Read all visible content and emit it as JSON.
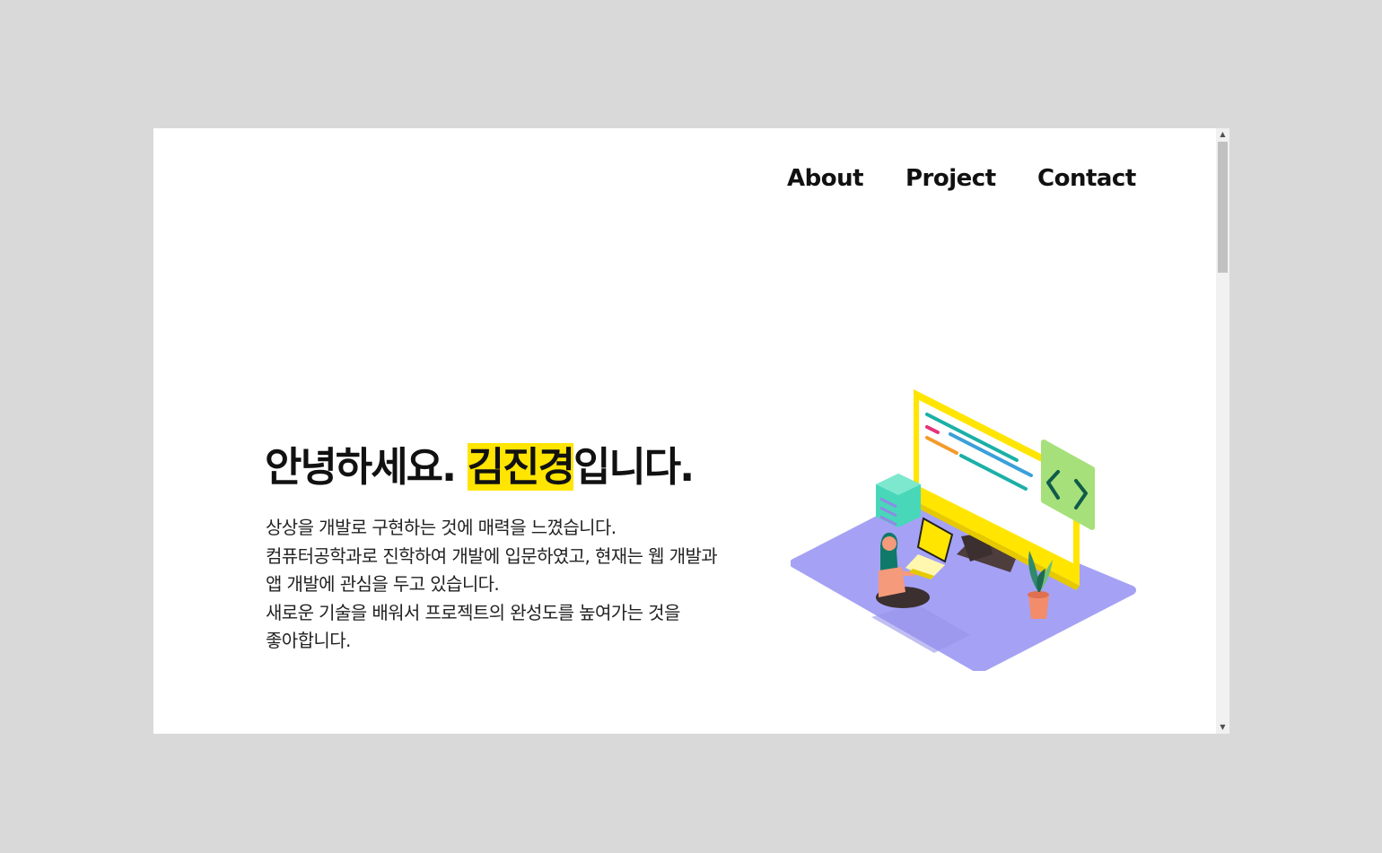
{
  "nav": {
    "items": [
      {
        "label": "About"
      },
      {
        "label": "Project"
      },
      {
        "label": "Contact"
      }
    ]
  },
  "hero": {
    "greeting": "안녕하세요. ",
    "name": "김진경",
    "suffix": "입니다.",
    "intro_lines": [
      "상상을 개발로 구현하는 것에 매력을 느꼈습니다.",
      "컴퓨터공학과로 진학하여 개발에 입문하였고, 현재는 웹 개발과",
      "앱 개발에 관심을 두고 있습니다.",
      "새로운 기술을 배워서 프로젝트의 완성도를 높여가는 것을",
      "좋아합니다."
    ],
    "illustration_icon": "developer-workspace-illustration"
  },
  "colors": {
    "page_background": "#d9d9d9",
    "highlight": "#ffe500",
    "platform": "#a5a2f5",
    "monitor": "#ffe500",
    "code_panel": "#a6e07a",
    "server": "#48d7b9",
    "plant_pot": "#f28c6a"
  },
  "scrollbar": {
    "up_icon": "arrow-up-icon",
    "down_icon": "arrow-down-icon"
  }
}
